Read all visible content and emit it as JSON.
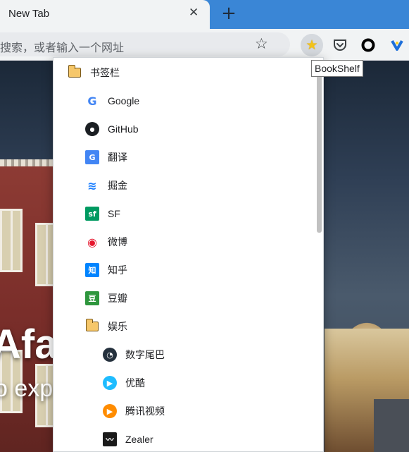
{
  "tab": {
    "title": "New Tab",
    "close": "✕",
    "new_tab": "+"
  },
  "toolbar": {
    "omnibox_placeholder": "搜索，或者输入一个网址",
    "star": "☆",
    "extensions": [
      "bookshelf-icon",
      "pocket-icon",
      "circle-icon",
      "v-icon"
    ]
  },
  "tooltip": {
    "text": "BookShelf"
  },
  "bookmarks": {
    "root": "书签栏",
    "items": [
      {
        "label": "Google",
        "icon": "google-icon",
        "icon_text": "G",
        "color": "#4285f4"
      },
      {
        "label": "GitHub",
        "icon": "github-icon",
        "icon_text": "●",
        "color": "#1b1f23"
      },
      {
        "label": "翻译",
        "icon": "translate-icon",
        "icon_text": "G",
        "color": "#4285f4"
      },
      {
        "label": "掘金",
        "icon": "juejin-icon",
        "icon_text": "≋",
        "color": "#1e80ff"
      },
      {
        "label": "SF",
        "icon": "sf-icon",
        "icon_text": "sf",
        "color": "#009a61"
      },
      {
        "label": "微博",
        "icon": "weibo-icon",
        "icon_text": "◉",
        "color": "#e6162d"
      },
      {
        "label": "知乎",
        "icon": "zhihu-icon",
        "icon_text": "知",
        "color": "#0084ff"
      },
      {
        "label": "豆瓣",
        "icon": "douban-icon",
        "icon_text": "豆",
        "color": "#2e963d"
      }
    ],
    "folder": "娱乐",
    "sub_items": [
      {
        "label": "数字尾巴",
        "icon": "dgtle-icon",
        "icon_text": "◔",
        "color": "#25313d"
      },
      {
        "label": "优酷",
        "icon": "youku-icon",
        "icon_text": "▶",
        "color": "#1ebcff"
      },
      {
        "label": "腾讯视频",
        "icon": "tencent-video-icon",
        "icon_text": "▶",
        "color": "#ff8c00"
      },
      {
        "label": "Zealer",
        "icon": "zealer-icon",
        "icon_text": "〰",
        "color": "#1a1a1a"
      }
    ]
  },
  "background": {
    "hero_line1": "Afa",
    "hero_line2": "o exp"
  }
}
